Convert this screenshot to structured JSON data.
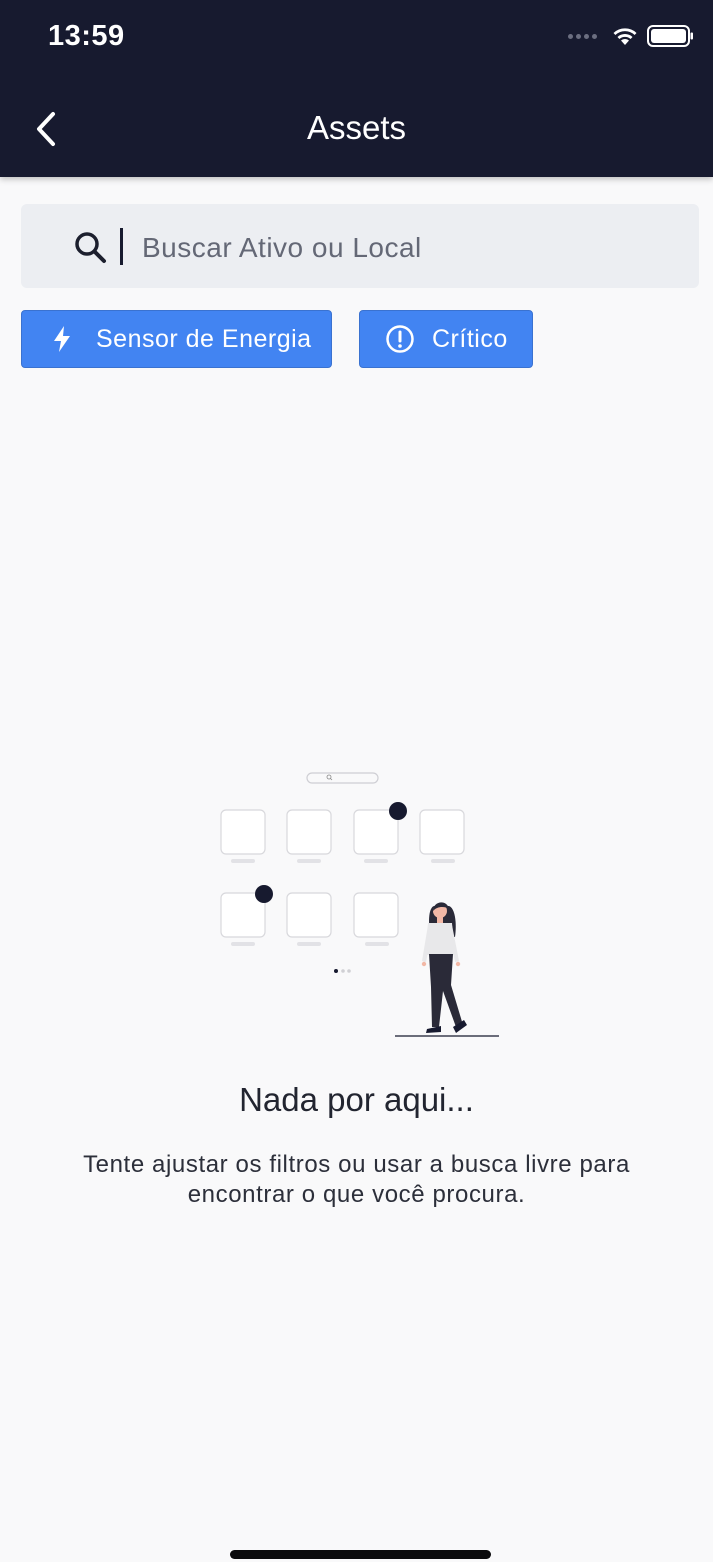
{
  "status_bar": {
    "time": "13:59",
    "icons": [
      "signal-dots-icon",
      "wifi-icon",
      "battery-icon"
    ]
  },
  "header": {
    "title": "Assets",
    "back_icon": "chevron-left-icon"
  },
  "search": {
    "placeholder": "Buscar Ativo ou Local",
    "value": "",
    "icon": "search-icon"
  },
  "filters": [
    {
      "label": "Sensor de Energia",
      "icon": "lightning-icon"
    },
    {
      "label": "Crítico",
      "icon": "alert-circle-icon"
    }
  ],
  "empty_state": {
    "title": "Nada por aqui...",
    "message": "Tente ajustar os filtros ou usar a busca livre para encontrar o que você procura.",
    "illustration": "woman-walking-empty-grid-illustration"
  },
  "colors": {
    "header_bg": "#171a2f",
    "chip_bg": "#4284f2",
    "search_bg": "#eceef2",
    "page_bg": "#f9f9fa"
  }
}
